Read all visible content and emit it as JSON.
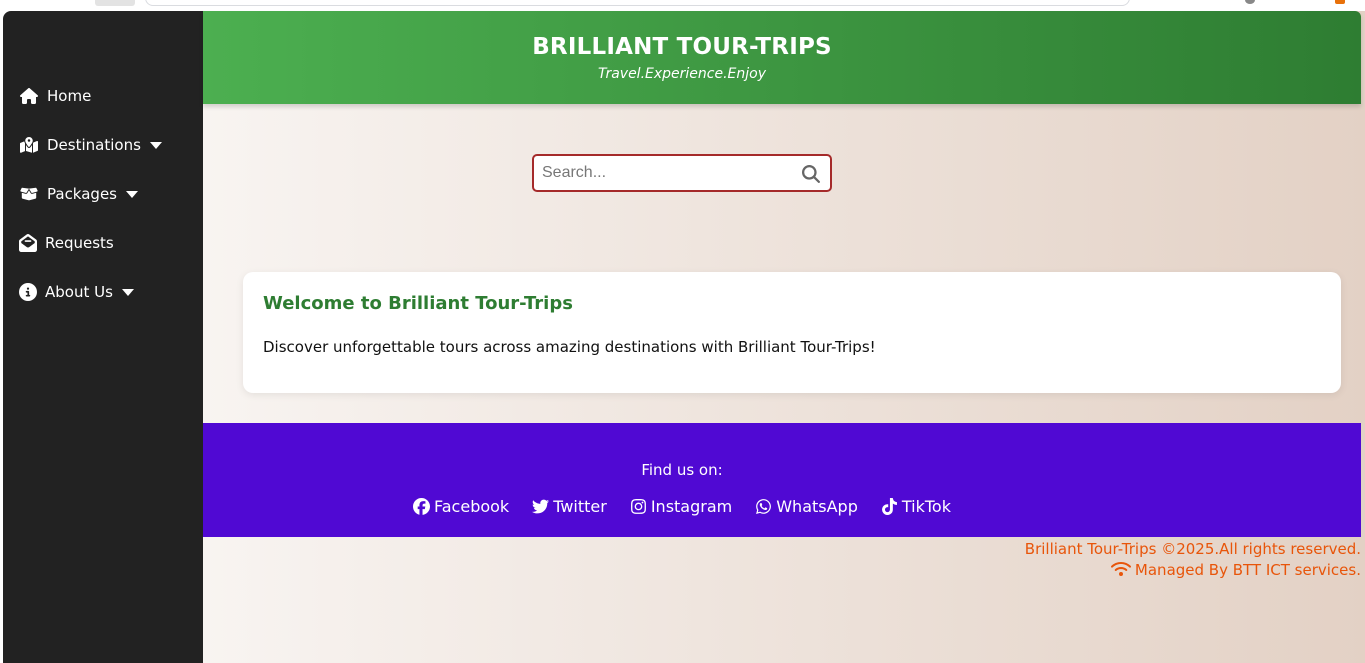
{
  "header": {
    "title": "BRILLIANT TOUR-TRIPS",
    "tagline": "Travel.Experience.Enjoy"
  },
  "sidebar": {
    "items": [
      {
        "label": "Home",
        "icon": "home-icon",
        "dropdown": false
      },
      {
        "label": "Destinations",
        "icon": "map-icon",
        "dropdown": true
      },
      {
        "label": "Packages",
        "icon": "box-open-icon",
        "dropdown": true
      },
      {
        "label": "Requests",
        "icon": "envelope-open-icon",
        "dropdown": false
      },
      {
        "label": "About Us",
        "icon": "info-circle-icon",
        "dropdown": true
      }
    ]
  },
  "search": {
    "placeholder": "Search..."
  },
  "welcome": {
    "heading": "Welcome to Brilliant Tour-Trips",
    "text": "Discover unforgettable tours across amazing destinations with Brilliant Tour-Trips!"
  },
  "footer": {
    "find_us": "Find us on:",
    "socials": [
      {
        "label": "Facebook",
        "icon": "facebook-icon"
      },
      {
        "label": "Twitter",
        "icon": "twitter-icon"
      },
      {
        "label": "Instagram",
        "icon": "instagram-icon"
      },
      {
        "label": "WhatsApp",
        "icon": "whatsapp-icon"
      },
      {
        "label": "TikTok",
        "icon": "tiktok-icon"
      }
    ]
  },
  "copyright": {
    "line1": "Brilliant Tour-Trips ©2025.All rights reserved.",
    "line2": "Managed By BTT ICT services."
  },
  "colors": {
    "sidebar_bg": "#222222",
    "header_green_start": "#4caf50",
    "header_green_end": "#2e7d32",
    "footer_purple": "#5009d3",
    "search_border": "#a52a2a",
    "copyright_orange": "#e8550a"
  }
}
